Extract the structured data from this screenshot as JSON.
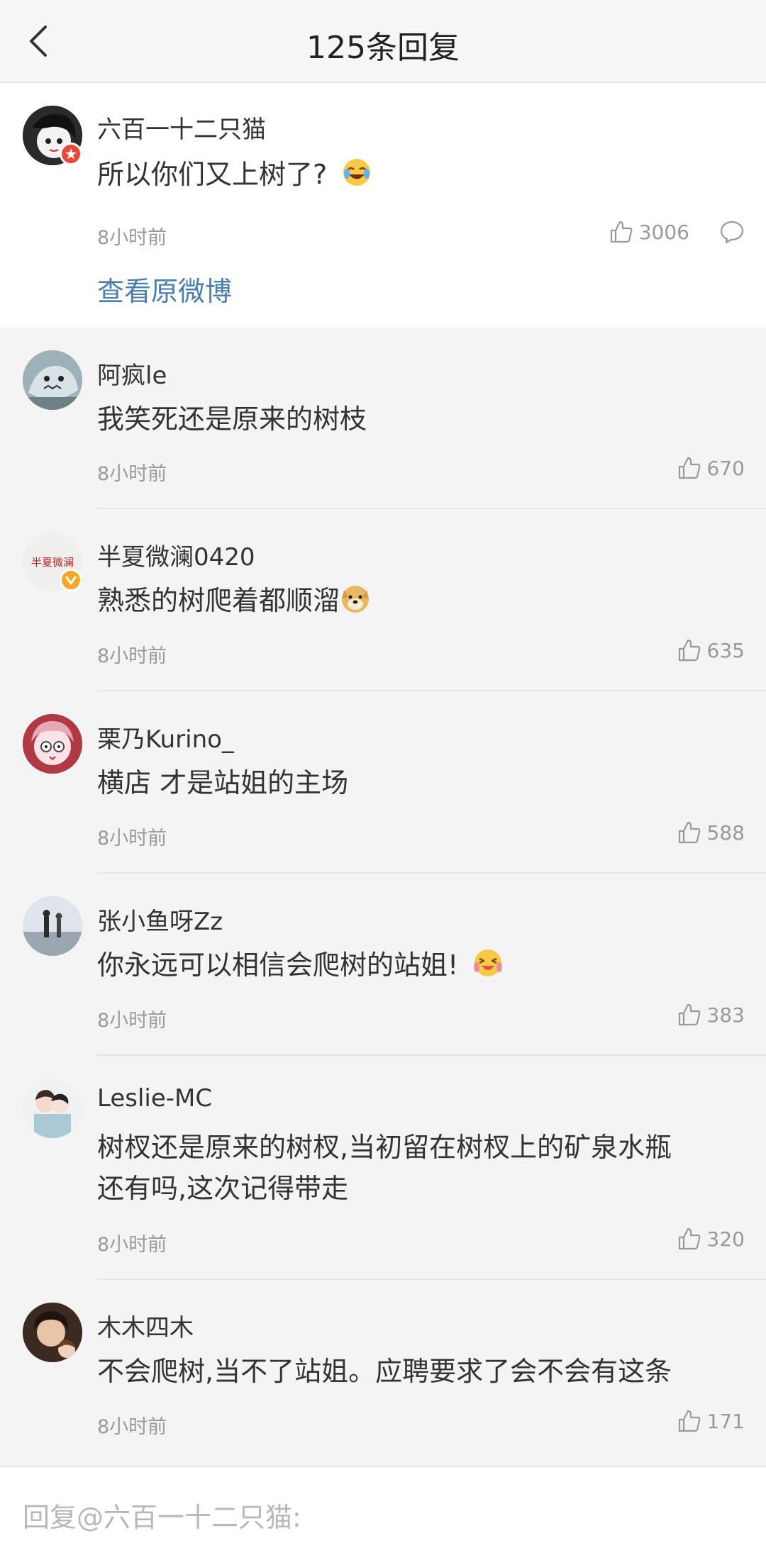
{
  "header": {
    "title": "125条回复"
  },
  "main_comment": {
    "user": "六百一十二只猫",
    "text": "所以你们又上树了?",
    "time": "8小时前",
    "likes": "3006",
    "view_original": "查看原微博"
  },
  "replies": [
    {
      "user": "阿疯le",
      "lines": [
        "我笑死还是原来的树枝"
      ],
      "time": "8小时前",
      "likes": "670"
    },
    {
      "user": "半夏微澜0420",
      "lines": [
        "熟悉的树爬着都顺溜"
      ],
      "time": "8小时前",
      "likes": "635"
    },
    {
      "user": "栗乃Kurino_",
      "lines": [
        "横店 才是站姐的主场"
      ],
      "time": "8小时前",
      "likes": "588"
    },
    {
      "user": "张小鱼呀Zz",
      "lines": [
        "你永远可以相信会爬树的站姐!"
      ],
      "time": "8小时前",
      "likes": "383"
    },
    {
      "user": "Leslie-MC",
      "lines": [
        "树杈还是原来的树杈,当初留在树杈上的矿泉水瓶",
        "还有吗,这次记得带走"
      ],
      "time": "8小时前",
      "likes": "320"
    },
    {
      "user": "木木四木",
      "lines": [
        "不会爬树,当不了站姐。应聘要求了会不会有这条"
      ],
      "time": "8小时前",
      "likes": "171"
    }
  ],
  "avatar_texts": {
    "banxia": "半夏微澜"
  },
  "footer": {
    "placeholder": "回复@六百一十二只猫:"
  },
  "colors": {
    "link": "#4a7db0",
    "muted": "#9a9a9a",
    "badge_red": "#e8483a",
    "badge_gold": "#f5a623"
  }
}
